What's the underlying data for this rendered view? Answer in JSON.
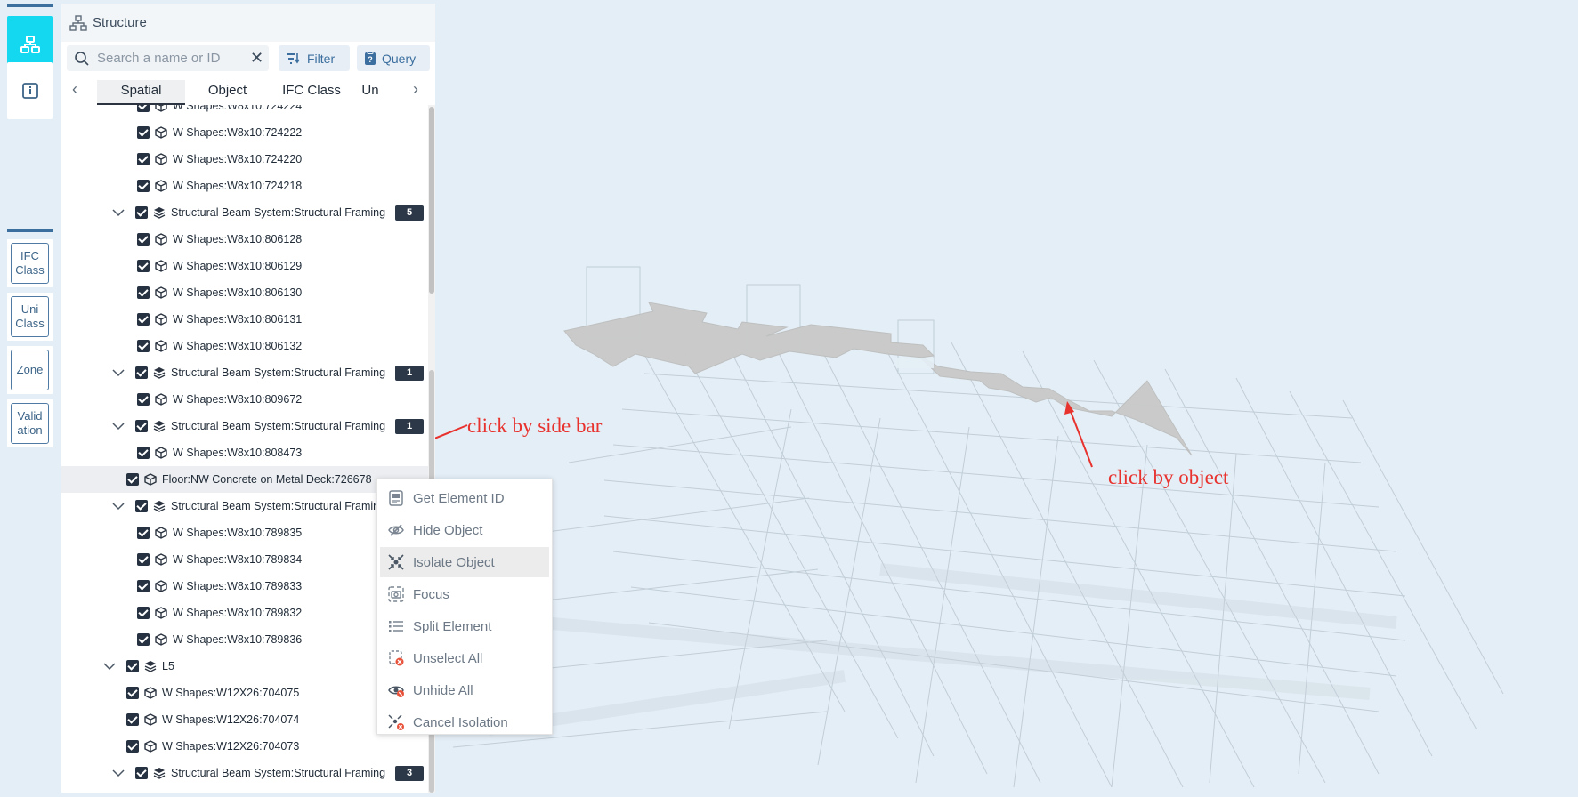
{
  "rail": {
    "buttons": [
      {
        "icon": "structure-icon",
        "active": true
      },
      {
        "icon": "info-icon",
        "active": false
      }
    ],
    "side_tabs": [
      "IFC\nClass",
      "Uni\nClass",
      "Zone",
      "Valid\nation"
    ]
  },
  "panel": {
    "title": "Structure",
    "search": {
      "placeholder": "Search a name or ID",
      "value": ""
    },
    "filter_label": "Filter",
    "query_label": "Query",
    "tabs": [
      {
        "label": "Spatial",
        "active": true
      },
      {
        "label": "Object",
        "active": false
      },
      {
        "label": "IFC Class",
        "active": false
      },
      {
        "label": "Un",
        "active": false
      }
    ]
  },
  "tree": [
    {
      "label": "W Shapes:W8x10:724224",
      "level": 2,
      "type": "object"
    },
    {
      "label": "W Shapes:W8x10:724222",
      "level": 2,
      "type": "object"
    },
    {
      "label": "W Shapes:W8x10:724220",
      "level": 2,
      "type": "object"
    },
    {
      "label": "W Shapes:W8x10:724218",
      "level": 2,
      "type": "object"
    },
    {
      "label": "Structural Beam System:Structural Framing",
      "level": 1,
      "type": "group",
      "badge": "5"
    },
    {
      "label": "W Shapes:W8x10:806128",
      "level": 2,
      "type": "object"
    },
    {
      "label": "W Shapes:W8x10:806129",
      "level": 2,
      "type": "object"
    },
    {
      "label": "W Shapes:W8x10:806130",
      "level": 2,
      "type": "object"
    },
    {
      "label": "W Shapes:W8x10:806131",
      "level": 2,
      "type": "object"
    },
    {
      "label": "W Shapes:W8x10:806132",
      "level": 2,
      "type": "object"
    },
    {
      "label": "Structural Beam System:Structural Framing",
      "level": 1,
      "type": "group",
      "badge": "1"
    },
    {
      "label": "W Shapes:W8x10:809672",
      "level": 2,
      "type": "object"
    },
    {
      "label": "Structural Beam System:Structural Framing",
      "level": 1,
      "type": "group",
      "badge": "1"
    },
    {
      "label": "W Shapes:W8x10:808473",
      "level": 2,
      "type": "object"
    },
    {
      "label": "Floor:NW Concrete on Metal Deck:726678",
      "level": 1,
      "type": "object",
      "selected": true
    },
    {
      "label": "Structural Beam System:Structural Framin",
      "level": 1,
      "type": "group"
    },
    {
      "label": "W Shapes:W8x10:789835",
      "level": 2,
      "type": "object"
    },
    {
      "label": "W Shapes:W8x10:789834",
      "level": 2,
      "type": "object"
    },
    {
      "label": "W Shapes:W8x10:789833",
      "level": 2,
      "type": "object"
    },
    {
      "label": "W Shapes:W8x10:789832",
      "level": 2,
      "type": "object"
    },
    {
      "label": "W Shapes:W8x10:789836",
      "level": 2,
      "type": "object"
    },
    {
      "label": "L5",
      "level": 0,
      "type": "group"
    },
    {
      "label": "W Shapes:W12X26:704075",
      "level": 1,
      "type": "object"
    },
    {
      "label": "W Shapes:W12X26:704074",
      "level": 1,
      "type": "object"
    },
    {
      "label": "W Shapes:W12X26:704073",
      "level": 1,
      "type": "object"
    },
    {
      "label": "Structural Beam System:Structural Framing",
      "level": 1,
      "type": "group",
      "badge": "3"
    }
  ],
  "context_menu": [
    {
      "label": "Get Element ID",
      "icon": "id-card-icon"
    },
    {
      "label": "Hide Object",
      "icon": "eye-off-icon"
    },
    {
      "label": "Isolate Object",
      "icon": "isolate-icon",
      "hover": true
    },
    {
      "label": "Focus",
      "icon": "focus-camera-icon"
    },
    {
      "label": "Split Element",
      "icon": "list-split-icon"
    },
    {
      "label": "Unselect All",
      "icon": "unselect-icon"
    },
    {
      "label": "Unhide All",
      "icon": "unhide-icon"
    },
    {
      "label": "Cancel Isolation",
      "icon": "cancel-isolation-icon"
    }
  ],
  "annotations": {
    "sidebar": "click by side bar",
    "object": "click by object"
  },
  "colors": {
    "accent": "#14d8f0",
    "annotation": "#e8322e",
    "background": "#e4eef6"
  }
}
